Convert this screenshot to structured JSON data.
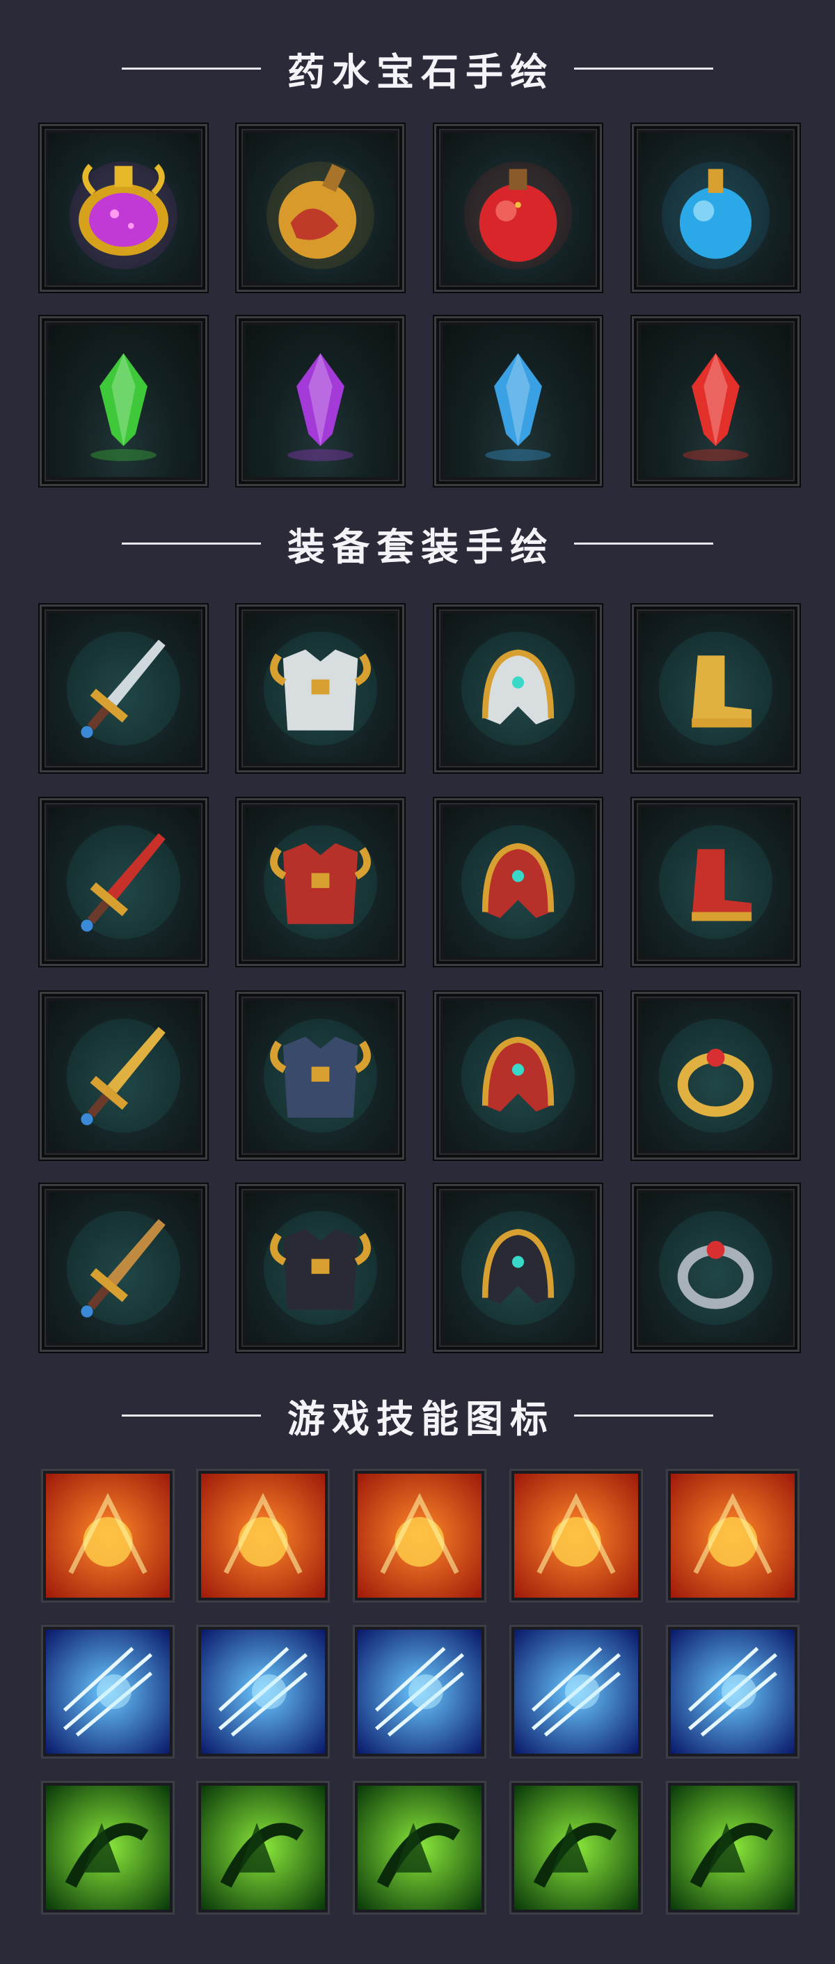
{
  "sections": [
    {
      "title": "药水宝石手绘"
    },
    {
      "title": "装备套装手绘"
    },
    {
      "title": "游戏技能图标"
    }
  ],
  "potions": [
    {
      "icon": "purple-gold-potion-icon",
      "color": "#c23ad6"
    },
    {
      "icon": "red-gold-orb-potion-icon",
      "color": "#d89a2a"
    },
    {
      "icon": "red-potion-flask-icon",
      "color": "#d8262a"
    },
    {
      "icon": "blue-potion-flask-icon",
      "color": "#2aa8e8"
    }
  ],
  "gems": [
    {
      "icon": "green-crystal-icon",
      "color": "#3fc83a"
    },
    {
      "icon": "purple-crystal-icon",
      "color": "#a43ad8"
    },
    {
      "icon": "blue-crystal-icon",
      "color": "#3aa2e4"
    },
    {
      "icon": "red-crystal-icon",
      "color": "#e4302a"
    }
  ],
  "equipment_sets": [
    [
      {
        "icon": "steel-sword-icon"
      },
      {
        "icon": "silver-gold-chest-armor-icon"
      },
      {
        "icon": "silver-gold-helmet-icon"
      },
      {
        "icon": "golden-boots-icon"
      }
    ],
    [
      {
        "icon": "red-gold-sword-icon"
      },
      {
        "icon": "red-gold-chest-armor-icon"
      },
      {
        "icon": "red-gold-helmet-icon"
      },
      {
        "icon": "red-boots-icon"
      }
    ],
    [
      {
        "icon": "golden-sword-icon"
      },
      {
        "icon": "blue-scale-armor-icon"
      },
      {
        "icon": "feathered-helmet-icon"
      },
      {
        "icon": "golden-ring-icon"
      }
    ],
    [
      {
        "icon": "bronze-sword-icon"
      },
      {
        "icon": "dark-chest-armor-icon"
      },
      {
        "icon": "horned-helmet-icon"
      },
      {
        "icon": "silver-ring-icon"
      }
    ]
  ],
  "skills": [
    [
      {
        "icon": "fire-strike-icon"
      },
      {
        "icon": "meteor-icon"
      },
      {
        "icon": "fire-demon-icon"
      },
      {
        "icon": "fire-eruption-icon"
      },
      {
        "icon": "fire-sword-explosion-icon"
      }
    ],
    [
      {
        "icon": "ice-arrows-icon"
      },
      {
        "icon": "ice-vortex-icon"
      },
      {
        "icon": "ice-blades-icon"
      },
      {
        "icon": "lightning-icon"
      },
      {
        "icon": "ice-pillar-icon"
      }
    ],
    [
      {
        "icon": "nature-dash-icon"
      },
      {
        "icon": "nature-buff-icon"
      },
      {
        "icon": "thorn-vine-icon"
      },
      {
        "icon": "vine-grab-icon"
      },
      {
        "icon": "nature-boot-icon"
      }
    ]
  ]
}
